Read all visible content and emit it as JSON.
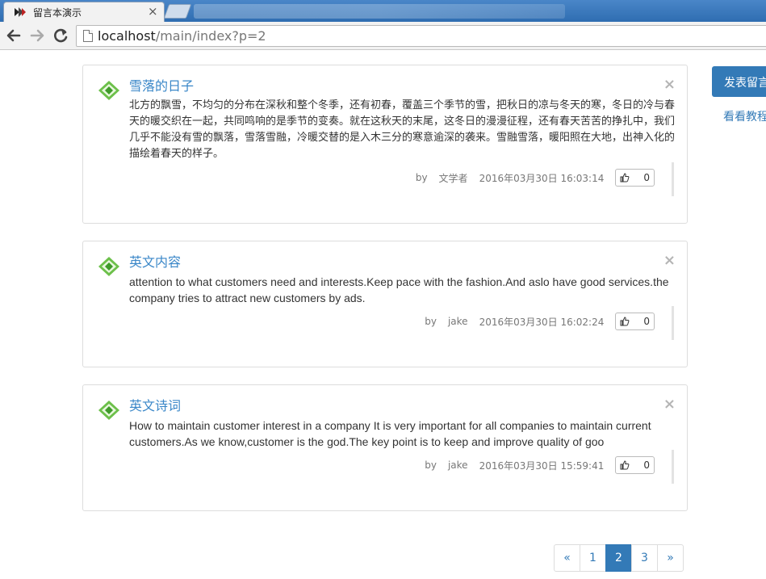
{
  "browser": {
    "tab_title": "留言本演示",
    "tab_close": "×",
    "url_host": "localhost",
    "url_path": "/main/index?p=2"
  },
  "sidebar": {
    "post_button": "发表留言",
    "tutorial_link": "看看教程"
  },
  "messages": [
    {
      "title": "雪落的日子",
      "body": "北方的飘雪，不均匀的分布在深秋和整个冬季，还有初春，覆盖三个季节的雪，把秋日的凉与冬天的寒，冬日的冷与春天的暖交织在一起，共同鸣响的是季节的变奏。就在这秋天的末尾，这冬日的漫漫征程，还有春天苦苦的挣扎中，我们几乎不能没有雪的飘落，雪落雪融，冷暖交替的是入木三分的寒意逾深的袭来。雪融雪落，暖阳照在大地，出神入化的描绘着春天的样子。",
      "by_label": "by",
      "author": "文学者",
      "time": "2016年03月30日 16:03:14",
      "likes": "0",
      "close": "×"
    },
    {
      "title": "英文内容",
      "body": "attention to what customers need and interests.Keep pace with the fashion.And aslo have good services.the company tries to attract new customers by ads.",
      "by_label": "by",
      "author": "jake",
      "time": "2016年03月30日 16:02:24",
      "likes": "0",
      "close": "×"
    },
    {
      "title": "英文诗词",
      "body": "How to maintain customer interest in a company It is very important for all companies to maintain current customers.As we know,customer is the god.The key point is to keep and improve quality of goo",
      "by_label": "by",
      "author": "jake",
      "time": "2016年03月30日 15:59:41",
      "likes": "0",
      "close": "×"
    }
  ],
  "pagination": {
    "prev": "«",
    "pages": [
      "1",
      "2",
      "3"
    ],
    "current": "2",
    "next": "»"
  },
  "colors": {
    "accent": "#337ab7",
    "title_link": "#3a87c8",
    "icon_green": "#5cb85c"
  }
}
